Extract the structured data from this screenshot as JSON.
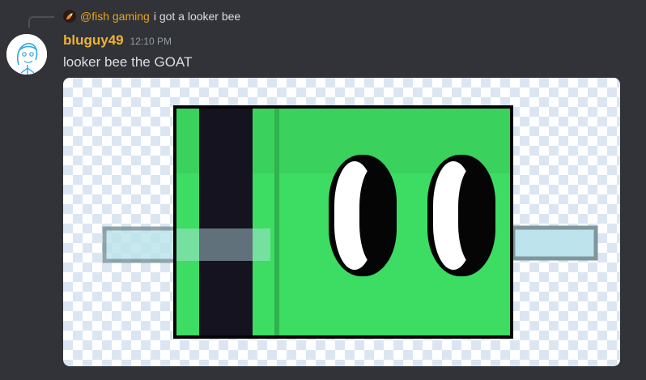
{
  "reply": {
    "author": "@fish gaming",
    "text": "i got a looker bee",
    "avatar_icon": "fish-gaming-avatar"
  },
  "message": {
    "author": "bluguy49",
    "timestamp": "12:10 PM",
    "content": "looker bee the GOAT",
    "author_color": "#f0b232",
    "avatar_icon": "sketch-face-avatar"
  },
  "attachment": {
    "type": "image",
    "subject": "looker-bee-character",
    "colors": {
      "body": "#3ddc63",
      "stripe": "#15131f",
      "wing": "#bde4ec"
    }
  }
}
